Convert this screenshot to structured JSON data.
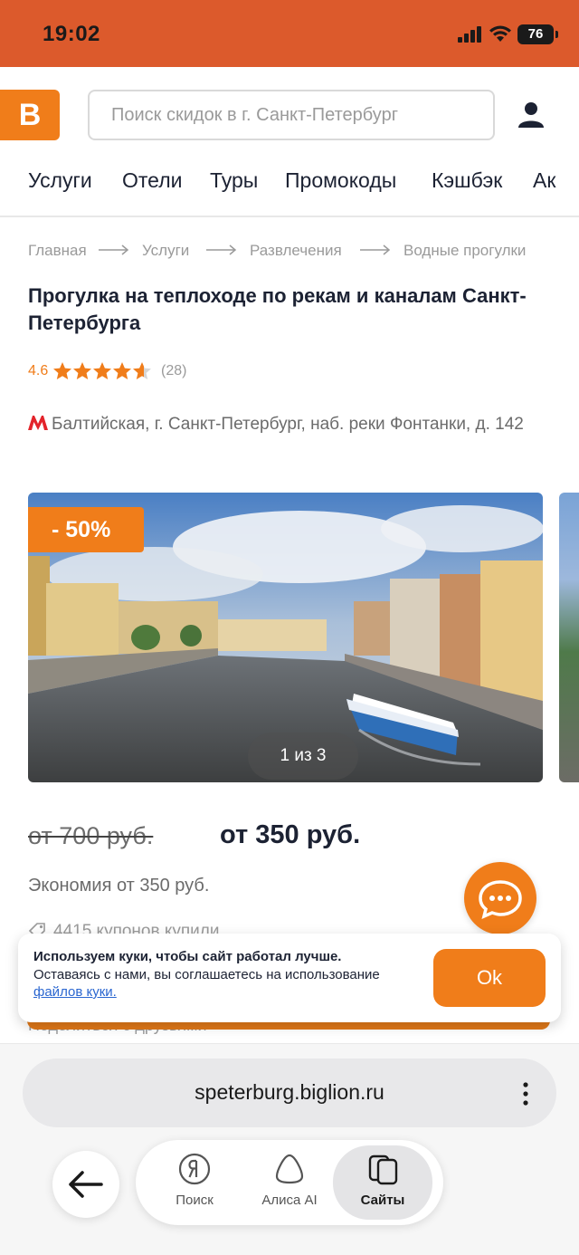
{
  "status_bar": {
    "time": "19:02",
    "battery": "76"
  },
  "header": {
    "logo": "B",
    "search_placeholder": "Поиск скидок в г. Санкт-Петербург"
  },
  "nav": {
    "items": [
      "Услуги",
      "Отели",
      "Туры",
      "Промокоды",
      "Кэшбэк",
      "Ак"
    ]
  },
  "breadcrumbs": [
    "Главная",
    "Услуги",
    "Развлечения",
    "Водные прогулки"
  ],
  "deal": {
    "title": "Прогулка на теплоходе по рекам и каналам Санкт-Петербурга",
    "rating": "4.6",
    "rating_stars": 4.6,
    "reviews": "(28)",
    "address": "Балтийская, г. Санкт-Петербург, наб. реки Фонтанки, д. 142",
    "discount": "- 50%",
    "gallery_counter": "1 из 3",
    "old_price": "от 700 руб.",
    "new_price": "от 350 руб.",
    "savings": "Экономия от 350 руб.",
    "sold": "4415 купонов купили",
    "share": "Поделиться с друзьями"
  },
  "cookie": {
    "line1": "Используем куки, чтобы сайт работал лучше.",
    "line2": "Оставаясь с нами, вы соглашаетесь на использование",
    "link": "файлов куки.",
    "ok": "Ok"
  },
  "browser": {
    "url": "speterburg.biglion.ru",
    "tabs": [
      "Поиск",
      "Алиса AI",
      "Сайты"
    ]
  },
  "colors": {
    "accent": "#f07d1a",
    "status_bar": "#dc5a2c",
    "text_dark": "#1c2233"
  }
}
